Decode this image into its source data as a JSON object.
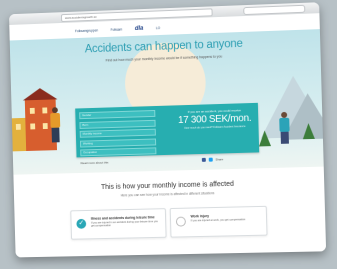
{
  "browser": {
    "url": "www.accidentsgrowth.se"
  },
  "header": {
    "logos": [
      "Folksamgruppen",
      "Folksam",
      "dla",
      "LO"
    ]
  },
  "hero": {
    "title": "Accidents can happen to anyone",
    "subtitle": "Find out how much your monthly income would be if something happens to you",
    "calculator": {
      "fields": [
        "Gender",
        "Born",
        "Monthly income",
        "Working",
        "Occupation"
      ],
      "intro": "If you are an accident, you could receive",
      "amount": "17 300 SEK/mon.",
      "note": "How much do you need? Folksam Accident Insurance"
    },
    "read_more": "Read more about this",
    "share_label": "Share"
  },
  "section": {
    "title": "This is how your monthly income is affected",
    "subtitle": "Here you can see how your income is affected in different situations",
    "cards": [
      {
        "title": "Illness and accidents during leisure time",
        "desc": "If you are injured in an accident during your leisure time you get compensation",
        "icon": "check-icon"
      },
      {
        "title": "Work injury",
        "desc": "If you are injured at work, you get compensation",
        "icon": "circle-icon"
      }
    ]
  },
  "colors": {
    "accent": "#27aeb0",
    "title": "#2f9fb3"
  }
}
